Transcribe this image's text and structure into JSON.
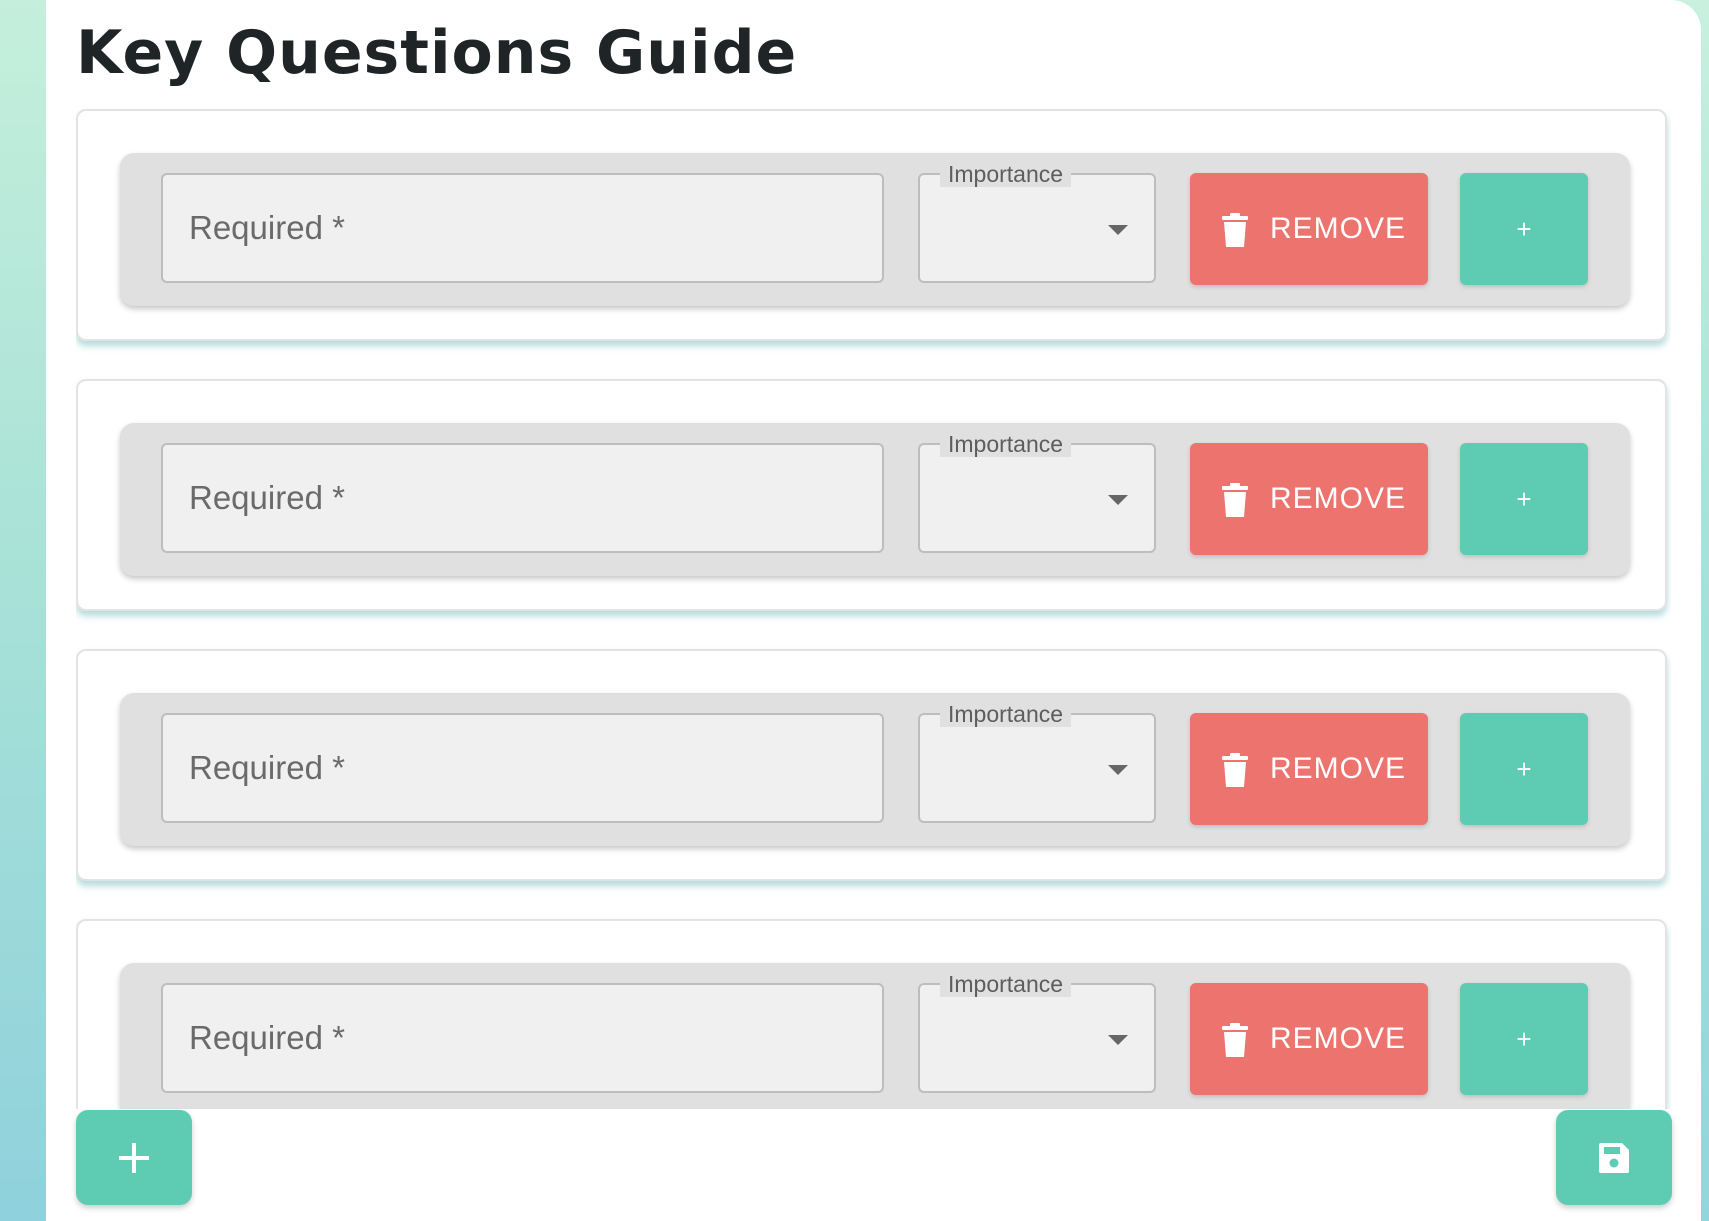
{
  "page": {
    "title": "Key Questions Guide"
  },
  "colors": {
    "accent": "#5ecbb3",
    "danger": "#ec736e",
    "row_background": "#e0e0e0",
    "field_background": "#f0f0f0"
  },
  "rows": [
    {
      "placeholder": "Required *",
      "value": "",
      "select_label": "Importance",
      "select_value": "",
      "remove_label": "REMOVE",
      "add_label": "+"
    },
    {
      "placeholder": "Required *",
      "value": "",
      "select_label": "Importance",
      "select_value": "",
      "remove_label": "REMOVE",
      "add_label": "+"
    },
    {
      "placeholder": "Required *",
      "value": "",
      "select_label": "Importance",
      "select_value": "",
      "remove_label": "REMOVE",
      "add_label": "+"
    },
    {
      "placeholder": "Required *",
      "value": "",
      "select_label": "Importance",
      "select_value": "",
      "remove_label": "REMOVE",
      "add_label": "+"
    }
  ],
  "icons": {
    "remove": "trash-icon",
    "select": "chevron-down-icon",
    "add_row": "plus-icon",
    "save": "floppy-disk-icon"
  },
  "actions": {
    "add_row_icon": "plus-icon",
    "save_icon": "floppy-disk-icon"
  }
}
